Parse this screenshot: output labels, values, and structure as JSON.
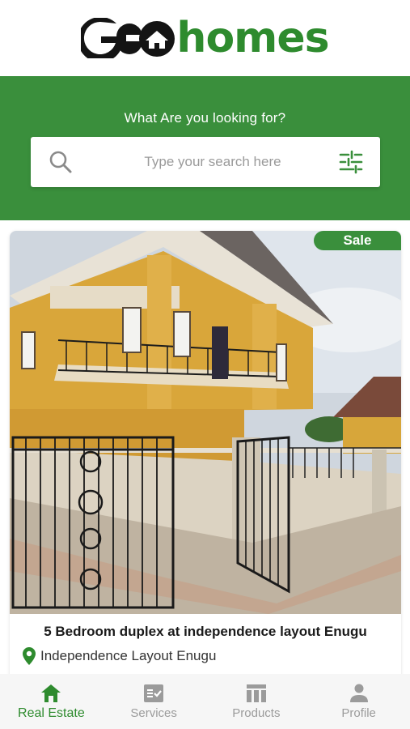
{
  "brand": {
    "logo_text_dark": "GEO",
    "logo_text_green": "homes"
  },
  "search": {
    "heading": "What Are you looking for?",
    "placeholder": "Type your search here"
  },
  "listing": {
    "badge": "Sale",
    "title": "5 Bedroom duplex at independence layout Enugu",
    "location": "Independence Layout Enugu"
  },
  "nav": {
    "items": [
      {
        "label": "Real Estate",
        "icon": "home-icon",
        "active": true
      },
      {
        "label": "Services",
        "icon": "checklist-icon",
        "active": false
      },
      {
        "label": "Products",
        "icon": "store-icon",
        "active": false
      },
      {
        "label": "Profile",
        "icon": "person-icon",
        "active": false
      }
    ]
  },
  "colors": {
    "brand_green": "#3a8f3c",
    "accent_green": "#2e8b2e",
    "inactive": "#9b9b9b"
  }
}
